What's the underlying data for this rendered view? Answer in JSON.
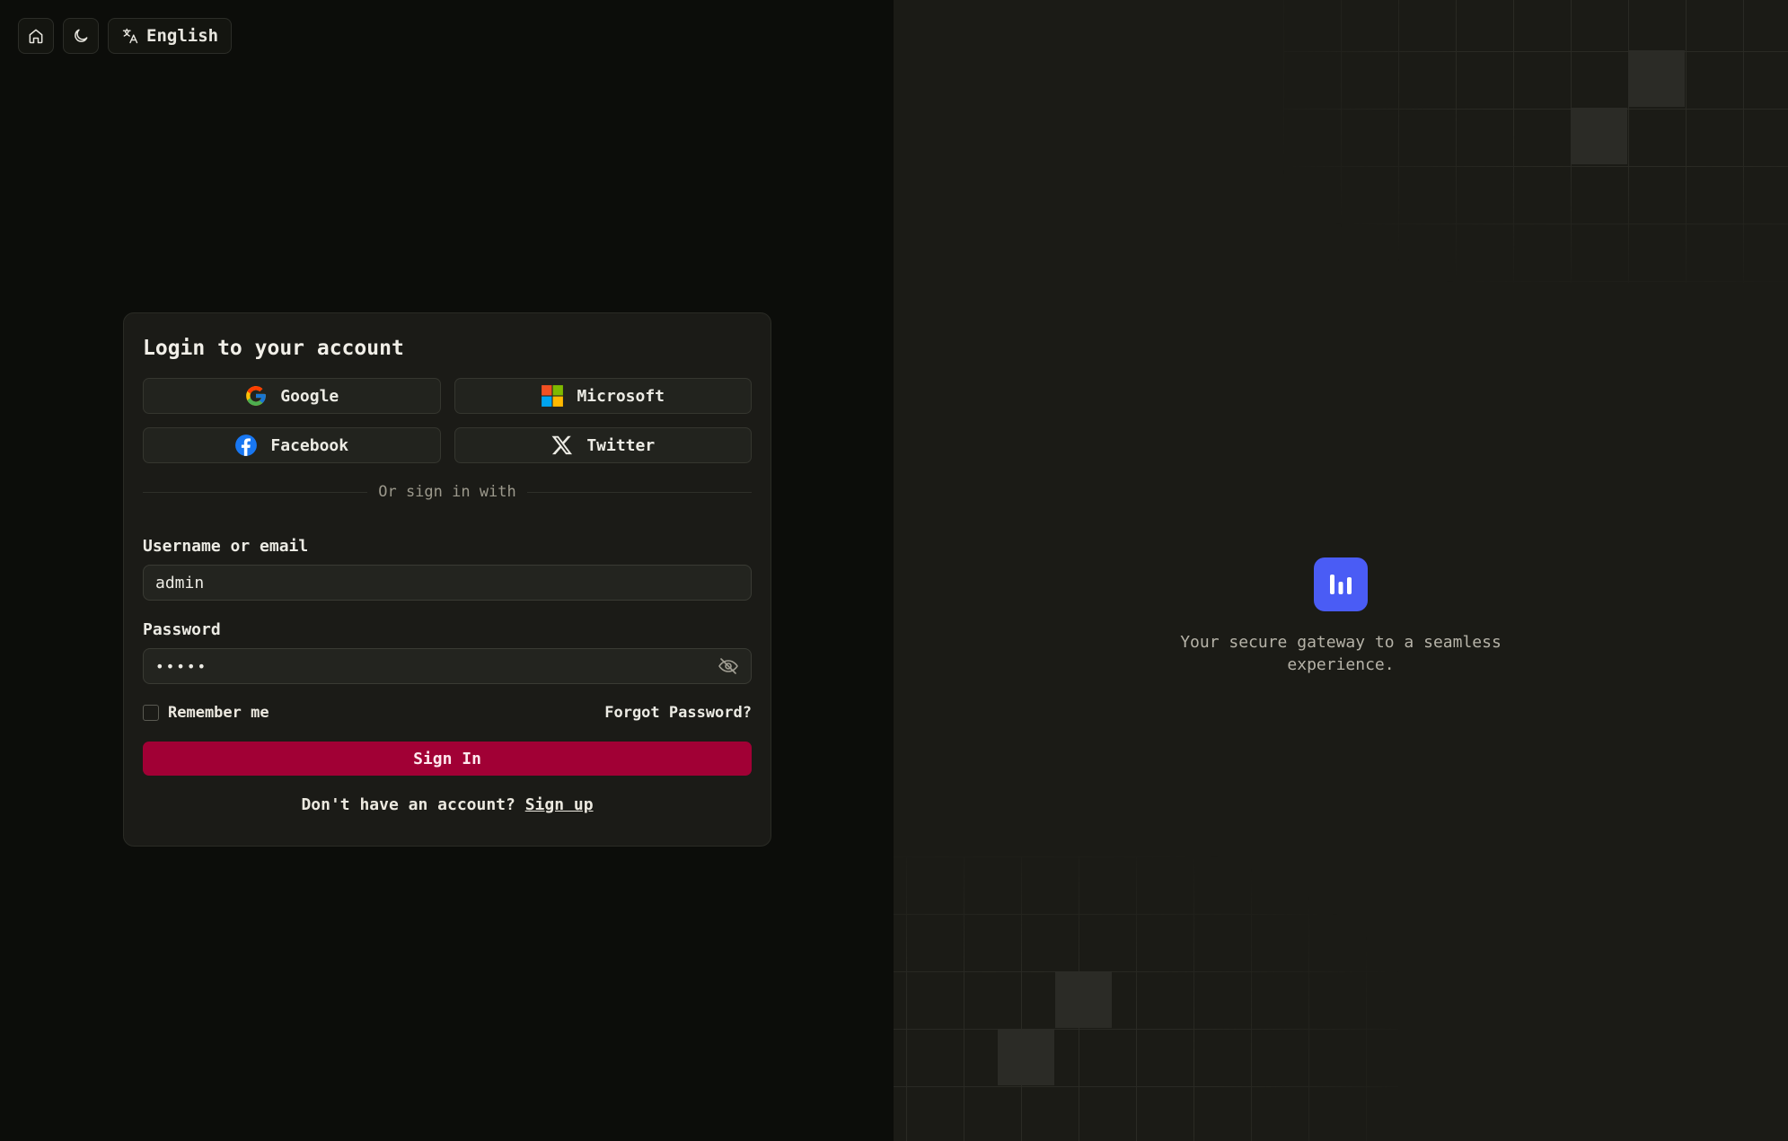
{
  "topbar": {
    "home_icon": "home-icon",
    "theme_icon": "moon-icon",
    "language_icon": "translate-icon",
    "language_label": "English"
  },
  "login": {
    "title": "Login to your account",
    "social": [
      {
        "label": "Google",
        "icon": "google-icon"
      },
      {
        "label": "Microsoft",
        "icon": "microsoft-icon"
      },
      {
        "label": "Facebook",
        "icon": "facebook-icon"
      },
      {
        "label": "Twitter",
        "icon": "x-twitter-icon"
      }
    ],
    "divider_text": "Or sign in with",
    "username_label": "Username or email",
    "username_value": "admin",
    "password_label": "Password",
    "password_value": "•••••",
    "remember_label": "Remember me",
    "remember_checked": false,
    "forgot_label": "Forgot Password?",
    "signin_label": "Sign In",
    "signup_prompt": "Don't have an account?",
    "signup_link": "Sign up"
  },
  "brand": {
    "logo_icon": "bar-chart-logo-icon",
    "tagline": "Your secure gateway to a seamless experience."
  },
  "colors": {
    "accent_signin": "#a10035",
    "logo_bg": "#4a5cf5",
    "left_bg": "#0c0d0a",
    "right_bg": "#1b1b16"
  }
}
